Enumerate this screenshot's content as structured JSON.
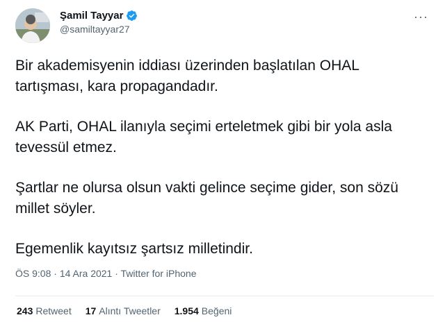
{
  "author": {
    "display_name": "Şamil Tayyar",
    "handle": "@samiltayyar27",
    "avatar_icon": "profile-photo",
    "verified_icon": "verified-badge-icon"
  },
  "more_menu": "···",
  "tweet": {
    "paragraphs": [
      "Bir akademisyenin iddiası üzerinden başlatılan OHAL tartışması, kara propagandadır.",
      "AK Parti, OHAL ilanıyla seçimi erteletmek gibi bir yola asla tevessül etmez.",
      "Şartlar ne olursa olsun vakti gelince seçime gider, son sözü millet söyler.",
      "Egemenlik kayıtsız şartsız milletindir."
    ],
    "time": "ÖS 9:08",
    "date": "14 Ara 2021",
    "source": "Twitter for iPhone",
    "separator": "·"
  },
  "stats": {
    "retweets_count": "243",
    "retweets_label": "Retweet",
    "quotes_count": "17",
    "quotes_label": "Alıntı Tweetler",
    "likes_count": "1.954",
    "likes_label": "Beğeni"
  },
  "colors": {
    "text": "#0f1419",
    "muted": "#536471",
    "verified": "#1d9bf0",
    "divider": "#e6ecf0"
  }
}
